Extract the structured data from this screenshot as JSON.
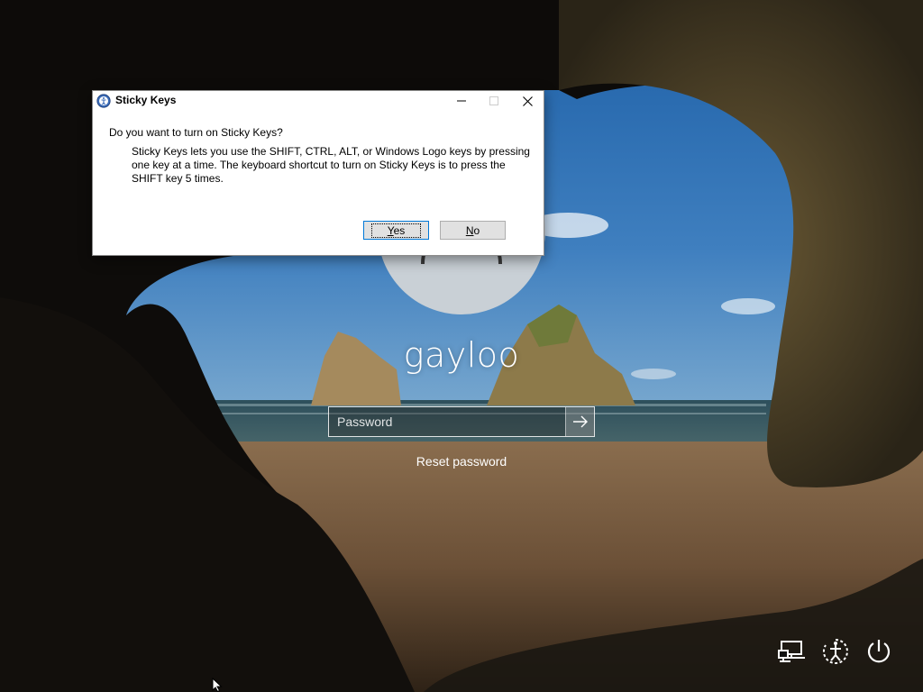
{
  "lockscreen": {
    "username": "gayloo",
    "password_placeholder": "Password",
    "reset_password_label": "Reset password",
    "bottom_icons": [
      "network-icon",
      "ease-of-access-icon",
      "power-icon"
    ]
  },
  "dialog": {
    "title": "Sticky Keys",
    "question": "Do you want to turn on Sticky Keys?",
    "body": "Sticky Keys lets you use the SHIFT, CTRL, ALT, or Windows Logo keys by pressing one key at a time. The keyboard shortcut to turn on Sticky Keys is to press the SHIFT key 5 times.",
    "yes_label_underlined": "Y",
    "yes_label_rest": "es",
    "no_label_underlined": "N",
    "no_label_rest": "o",
    "accent_color": "#0078d7"
  }
}
